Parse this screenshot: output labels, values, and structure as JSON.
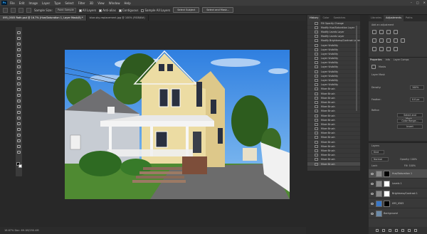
{
  "menu": [
    "File",
    "Edit",
    "Image",
    "Layer",
    "Type",
    "Select",
    "Filter",
    "3D",
    "View",
    "Window",
    "Help"
  ],
  "app_logo": "Ps",
  "options": {
    "sample": "Sample Size:",
    "point": "Point Sample",
    "all_layers": "All Layers",
    "sample_all": "Sample All Layers",
    "contiguous": "Contiguous",
    "anti_alias": "Anti-alias",
    "select_subject": "Select Subject",
    "select_mask": "Select and Mask..."
  },
  "doc_tabs": [
    "095_0505 Roth.psd @ 16.7% (Hue/Saturation 1, Layer Mask/8) *",
    "blue-sky-replacement.jpg @ 100% (RGB/8#)"
  ],
  "status": "16.67%    Doc: 69.1M/250.4M",
  "history": {
    "tabs": [
      "History",
      "Color",
      "Swatches"
    ],
    "items": [
      "Fill Opacity Change",
      "Modify Hue/Saturation Layer",
      "Modify Levels Layer",
      "Modify Levels Layer",
      "Modify Brightness/Contrast Layer",
      "Layer Visibility",
      "Layer Visibility",
      "Layer Visibility",
      "Layer Visibility",
      "Layer Visibility",
      "Layer Visibility",
      "Layer Visibility",
      "Layer Visibility",
      "Layer Visibility",
      "Layer Visibility",
      "Mixer Brush",
      "Mixer Brush",
      "Mixer Brush",
      "Mixer Brush",
      "Mixer Brush",
      "Mixer Brush",
      "Mixer Brush",
      "Mixer Brush",
      "Mixer Brush",
      "Mixer Brush",
      "Mixer Brush",
      "Mixer Brush",
      "Mixer Brush",
      "Mixer Brush",
      "Mixer Brush",
      "Mixer Brush",
      "Mixer Brush",
      "Mixer Brush"
    ]
  },
  "right_tabs": [
    "Libraries",
    "Adjustments",
    "Paths"
  ],
  "adjust_label": "Add an adjustment",
  "properties": {
    "tabs": [
      "Properties",
      "Info",
      "Layer Comps"
    ],
    "title": "Masks",
    "mask": "Layer Mask",
    "density": "Density:",
    "density_val": "100%",
    "feather": "Feather:",
    "feather_val": "0.0 px",
    "refine": "Refine:",
    "select_mask": "Select and Mask...",
    "color_range": "Color Range...",
    "invert": "Invert"
  },
  "layers": {
    "title": "Layers",
    "kind": "Kind",
    "blend": "Normal",
    "opacity": "Opacity: 100%",
    "lock": "Lock:",
    "fill": "Fill: 100%",
    "rows": [
      "Hue/Saturation 1",
      "Levels 1",
      "Brightness/Contrast 1",
      "095_0505",
      "Background"
    ]
  }
}
